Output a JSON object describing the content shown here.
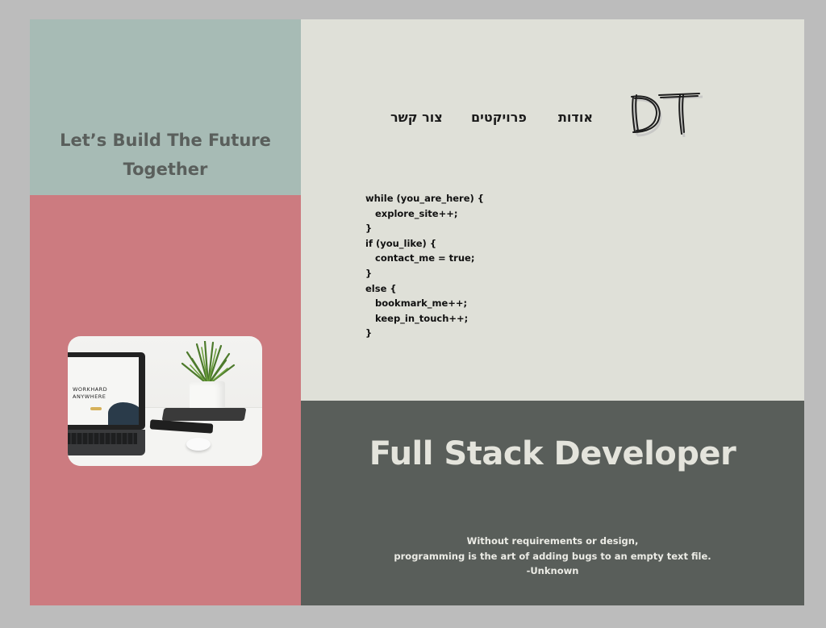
{
  "hero": {
    "tagline_line1": "Let’s Build The Future",
    "tagline_line2": "Together"
  },
  "photo": {
    "screen_text_line1": "WORKHARD",
    "screen_text_line2": "ANYWHERE"
  },
  "logo": {
    "text": "DT"
  },
  "nav": {
    "items": [
      {
        "label": "אודות"
      },
      {
        "label": "פרויקטים"
      },
      {
        "label": "צור קשר"
      }
    ]
  },
  "code": {
    "lines": [
      "while (you_are_here) {",
      "   explore_site++;",
      "}",
      "if (you_like) {",
      "   contact_me = true;",
      "}",
      "else {",
      "   bookmark_me++;",
      "   keep_in_touch++;",
      "}"
    ]
  },
  "banner": {
    "headline": "Full Stack Developer",
    "quote_line1": "Without requirements or design,",
    "quote_line2": "programming is the art of adding bugs to an empty text file.",
    "quote_author": "-Unknown"
  },
  "colors": {
    "sage": "#a7bbb5",
    "rose": "#cc7b80",
    "paper": "#dfe0d8",
    "slate": "#595e5a"
  }
}
